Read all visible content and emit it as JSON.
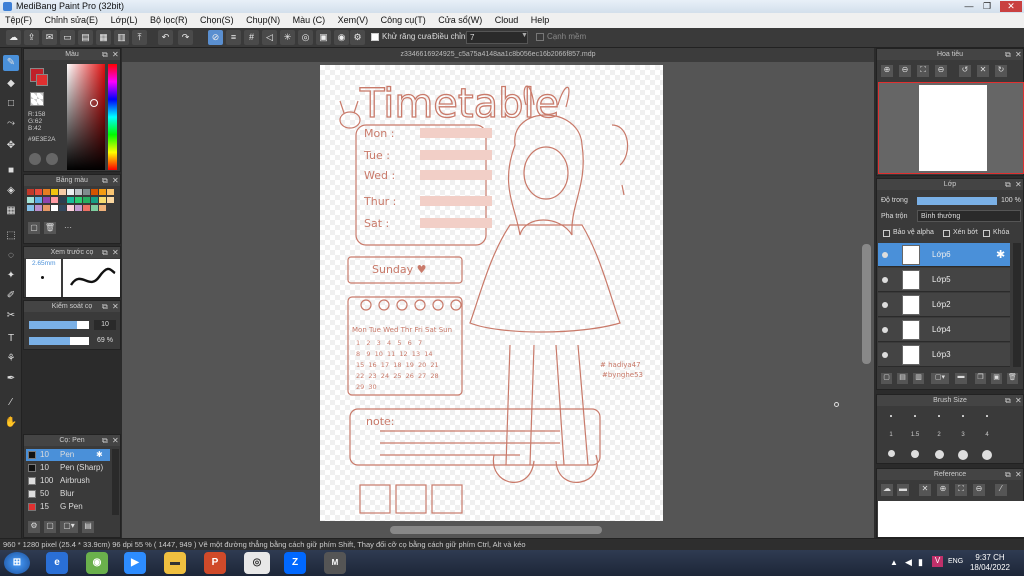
{
  "window": {
    "title": "MediBang Paint Pro (32bit)",
    "minimize": "—",
    "restore": "❐",
    "close": "✕"
  },
  "menu": [
    "Tệp(F)",
    "Chỉnh sửa(E)",
    "Lớp(L)",
    "Bộ lọc(R)",
    "Chọn(S)",
    "Chụp(N)",
    "Màu (C)",
    "Xem(V)",
    "Công cụ(T)",
    "Cửa sổ(W)",
    "Cloud",
    "Help"
  ],
  "toolbar": {
    "antialias_label": "Khử răng cưa",
    "correction_label": "Điều chỉnh",
    "correction_value": "7",
    "edge_label": "Cạnh mềm"
  },
  "document": {
    "tab": "z3346616924925_c5a75a4148aa1c8b056ec16b2066f857.mdp"
  },
  "panels": {
    "color": {
      "title": "Màu",
      "r": "R:158",
      "g": "G:62",
      "b": "B:42",
      "hex": "#9E3E2A",
      "fg": "#c0202a",
      "bg": "#e8e8e8"
    },
    "palette": {
      "title": "Bảng màu",
      "more": "···"
    },
    "preview": {
      "title": "Xem trước cọ",
      "size": "2.65mm"
    },
    "brush_control": {
      "title": "Kiểm soát cọ",
      "size_value": "10",
      "opacity_value": "69 %",
      "opacity_fraction": 0.69,
      "size_fraction": 0.8
    },
    "brushes": {
      "title": "Cọ: Pen",
      "items": [
        {
          "size": "10",
          "name": "Pen",
          "color": "#111111"
        },
        {
          "size": "10",
          "name": "Pen (Sharp)",
          "color": "#111111"
        },
        {
          "size": "100",
          "name": "Airbrush",
          "color": "#dddddd"
        },
        {
          "size": "50",
          "name": "Blur",
          "color": "#dddddd"
        },
        {
          "size": "15",
          "name": "G Pen",
          "color": "#e03030"
        }
      ]
    },
    "navigator": {
      "title": "Hoa tiêu"
    },
    "layer": {
      "title": "Lớp",
      "opacity_label": "Độ trong",
      "opacity_value": "100 %",
      "blend_label": "Pha trộn",
      "blend_value": "Bình thường",
      "protect_alpha": "Bảo vệ alpha",
      "clipping": "Xén bớt",
      "lock": "Khóa",
      "layers": [
        "Lớp6",
        "Lớp5",
        "Lớp2",
        "Lớp4",
        "Lớp3"
      ]
    },
    "brush_size": {
      "title": "Brush Size",
      "sizes": [
        "1",
        "1.5",
        "2",
        "3",
        "4"
      ]
    },
    "reference": {
      "title": "Reference"
    }
  },
  "artwork": {
    "title": "Timetable",
    "days": [
      "Mon  :",
      "Tue  :",
      "Wed  :",
      "Thur  :",
      "Sat  :"
    ],
    "sunday": "Sunday ♥",
    "cal_head": [
      "Mon",
      "Tue",
      "Wed",
      "Thr",
      "Fri",
      "Sat",
      "Sun"
    ],
    "cal_rows": [
      "1   2   3   4   5   6   7",
      "8   9  10  11  12  13  14",
      "15  16  17  18  19  20  21",
      "22  23  24  25  26  27  28",
      "29  30"
    ],
    "note": "note:",
    "sign1": "# hadiya47",
    "sign2": "#bynghe53"
  },
  "status": "960 * 1280 pixel   (25.4 * 33.9cm)  96 dpi   55 %   ( 1447, 949 )   Vẽ một đường thẳng bằng cách giữ phím Shift, Thay đổi cỡ cọ bằng cách giữ phím Ctrl, Alt và kéo",
  "taskbar": {
    "time": "9:37 CH",
    "date": "18/04/2022",
    "lang": "ENG"
  },
  "colors": {
    "accent": "#4a90d9",
    "sketch": "#c97a6a"
  }
}
